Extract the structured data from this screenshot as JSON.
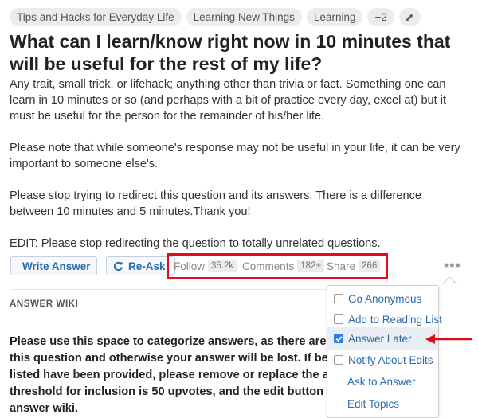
{
  "topics": {
    "items": [
      "Tips and Hacks for Everyday Life",
      "Learning New Things",
      "Learning",
      "+2"
    ],
    "edit_icon": "pencil-icon"
  },
  "question": {
    "title": "What can I learn/know right now in 10 minutes that will be useful for the rest of my life?",
    "body": [
      "Any trait, small trick, or lifehack; anything other than trivia or fact. Something one can learn in 10 minutes or so (and perhaps with a bit of practice every day, excel at) but it must be useful for the person for the remainder of his/her life.",
      "Please note that while someone's response may not be useful in your life, it can be very important to someone else's.",
      "Please stop trying to redirect this question and its answers. There is a difference between 10 minutes and 5 minutes.Thank you!",
      "EDIT: Please stop redirecting the question to totally unrelated questions."
    ]
  },
  "actions": {
    "write_answer": "Write Answer",
    "re_ask": "Re-Ask",
    "follow_label": "Follow",
    "follow_count": "35.2k",
    "comments_label": "Comments",
    "comments_count": "182+",
    "share_label": "Share",
    "share_count": "266",
    "more": "•••"
  },
  "answer_wiki": {
    "label": "ANSWER WIKI",
    "lines": [
      "Please use this space to categorize answers, as there are o",
      "this question and otherwise your answer will be lost. If bett",
      "listed have been provided, please remove or replace the an",
      "threshold for inclusion is 50 upvotes, and the edit button is",
      "answer wiki."
    ]
  },
  "menu": {
    "items": [
      {
        "label": "Go Anonymous",
        "checkbox": true,
        "checked": false
      },
      {
        "label": "Add to Reading List",
        "checkbox": true,
        "checked": false
      },
      {
        "label": "Answer Later",
        "checkbox": true,
        "checked": true
      },
      {
        "label": "Notify About Edits",
        "checkbox": true,
        "checked": false
      },
      {
        "label": "Ask to Answer",
        "checkbox": false
      },
      {
        "label": "Edit Topics",
        "checkbox": false
      }
    ]
  },
  "colors": {
    "link": "#2b6dad",
    "highlight_box": "#e30c1b",
    "annotation_arrow": "#e30c1b",
    "checkbox_checked": "#2d7ee6"
  }
}
